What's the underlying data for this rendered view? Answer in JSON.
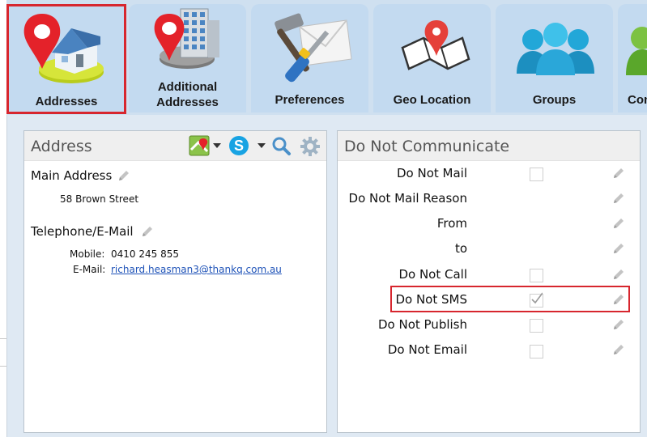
{
  "tabs": [
    {
      "label": "Addresses",
      "icon": "map-pin-house-icon",
      "selected": true
    },
    {
      "label_line1": "Additional",
      "label_line2": "Addresses",
      "icon": "map-pin-building-icon"
    },
    {
      "label": "Preferences",
      "icon": "tools-envelope-icon"
    },
    {
      "label": "Geo Location",
      "icon": "map-pin-map-icon"
    },
    {
      "label": "Groups",
      "icon": "people-group-icon"
    },
    {
      "label": "Con",
      "icon": "communication-icon"
    }
  ],
  "address_panel": {
    "title": "Address",
    "main_address_label": "Main Address",
    "main_address_value": "58 Brown Street",
    "telephone_label": "Telephone/E-Mail",
    "mobile_label": "Mobile:",
    "mobile_value": "0410 245 855",
    "email_label": "E-Mail:",
    "email_value": "richard.heasman3@thankq.com.au"
  },
  "dnc_panel": {
    "title": "Do Not Communicate",
    "rows": [
      {
        "label": "Do Not Mail",
        "has_checkbox": true,
        "checked": false
      },
      {
        "label": "Do Not Mail Reason",
        "has_checkbox": false
      },
      {
        "label": "From",
        "has_checkbox": false
      },
      {
        "label": "to",
        "has_checkbox": false
      },
      {
        "label": "Do Not Call",
        "has_checkbox": true,
        "checked": false
      },
      {
        "label": "Do Not SMS",
        "has_checkbox": true,
        "checked": true
      },
      {
        "label": "Do Not Publish",
        "has_checkbox": true,
        "checked": false
      },
      {
        "label": "Do Not Email",
        "has_checkbox": true,
        "checked": false
      }
    ]
  },
  "colors": {
    "highlight": "#d7262e",
    "tab_bg": "#c3daf0",
    "link": "#1f53b8"
  }
}
